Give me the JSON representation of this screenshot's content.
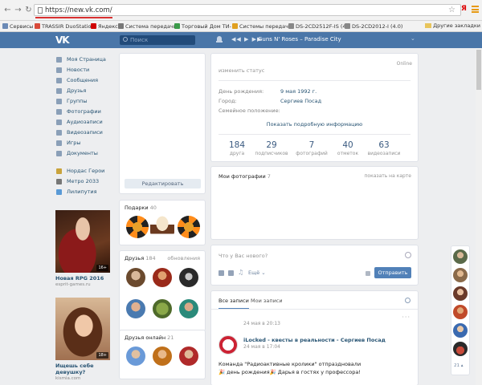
{
  "browser": {
    "url": "https://new.vk.com/",
    "bookmarks": [
      {
        "label": "Сервисы",
        "color": "#6b8ab6"
      },
      {
        "label": "TRASSIR DuoStation",
        "color": "#d94a3a"
      },
      {
        "label": "Яндекс",
        "color": "#d00000"
      },
      {
        "label": "Система передачи",
        "color": "#777777"
      },
      {
        "label": "Торговый Дом ТИ-",
        "color": "#3b9b4a"
      },
      {
        "label": "Системы передачи",
        "color": "#e0a020"
      },
      {
        "label": "DS-2CD2512F-IS (4",
        "color": "#888888"
      },
      {
        "label": "DS-2CD2012-I (4.0)",
        "color": "#888888"
      }
    ],
    "bookmarks_more": "Другие закладки"
  },
  "header": {
    "search_placeholder": "Поиск",
    "player_controls": "◀◀ ▶ ▶▶",
    "track": "Guns N' Roses – Paradise City"
  },
  "menu": {
    "items": [
      "Моя Страница",
      "Новости",
      "Сообщения",
      "Друзья",
      "Группы",
      "Фотографии",
      "Аудиозаписи",
      "Видеозаписи",
      "Игры",
      "Документы"
    ],
    "apps": [
      "Нордас Герои",
      "Метро 2033",
      "Лилипутия"
    ]
  },
  "ads": [
    {
      "title": "Новая RPG 2016",
      "sub": "esprit-games.ru",
      "badge": "16+"
    },
    {
      "title": "Ищешь себе девушку?",
      "sub": "kismia.com",
      "badge": "18+"
    }
  ],
  "profile": {
    "edit_button": "Редактировать",
    "online": "Online",
    "status": "изменить статус",
    "info": [
      {
        "label": "День рождения:",
        "value": "9 мая 1992 г."
      },
      {
        "label": "Город:",
        "value": "Сергиев Посад"
      },
      {
        "label": "Семейное положение:",
        "value": ""
      }
    ],
    "more_info": "Показать подробную информацию",
    "counters": [
      {
        "n": "184",
        "l": "друга"
      },
      {
        "n": "29",
        "l": "подписчиков"
      },
      {
        "n": "7",
        "l": "фотографий"
      },
      {
        "n": "40",
        "l": "отметок"
      },
      {
        "n": "63",
        "l": "видеозаписи"
      }
    ]
  },
  "gifts": {
    "title": "Подарки",
    "count": "40"
  },
  "friends": {
    "title": "Друзья",
    "count": "184",
    "right": "обновления"
  },
  "friends_online": {
    "title": "Друзья онлайн",
    "count": "21"
  },
  "photos": {
    "title": "Мои фотографии",
    "count": "7",
    "right": "показать на карте"
  },
  "composer": {
    "placeholder": "Что у Вас нового?",
    "more": "Ещё ⌄",
    "send": "Отправить"
  },
  "feed": {
    "tabs": [
      "Все записи",
      "Мои записи"
    ],
    "top_date": "24 мая в 20:13",
    "author": "iLocked - квесты в реальности - Сергиев Посад",
    "date": "24 мая в 17:04",
    "text_line1": "Команда \"Радиоактивные кролики\" отпраздновали",
    "text_line2": "🎉 день рождения🎉 Дарья в гостях у профессора!"
  },
  "rail": {
    "count": "21 ▴"
  }
}
